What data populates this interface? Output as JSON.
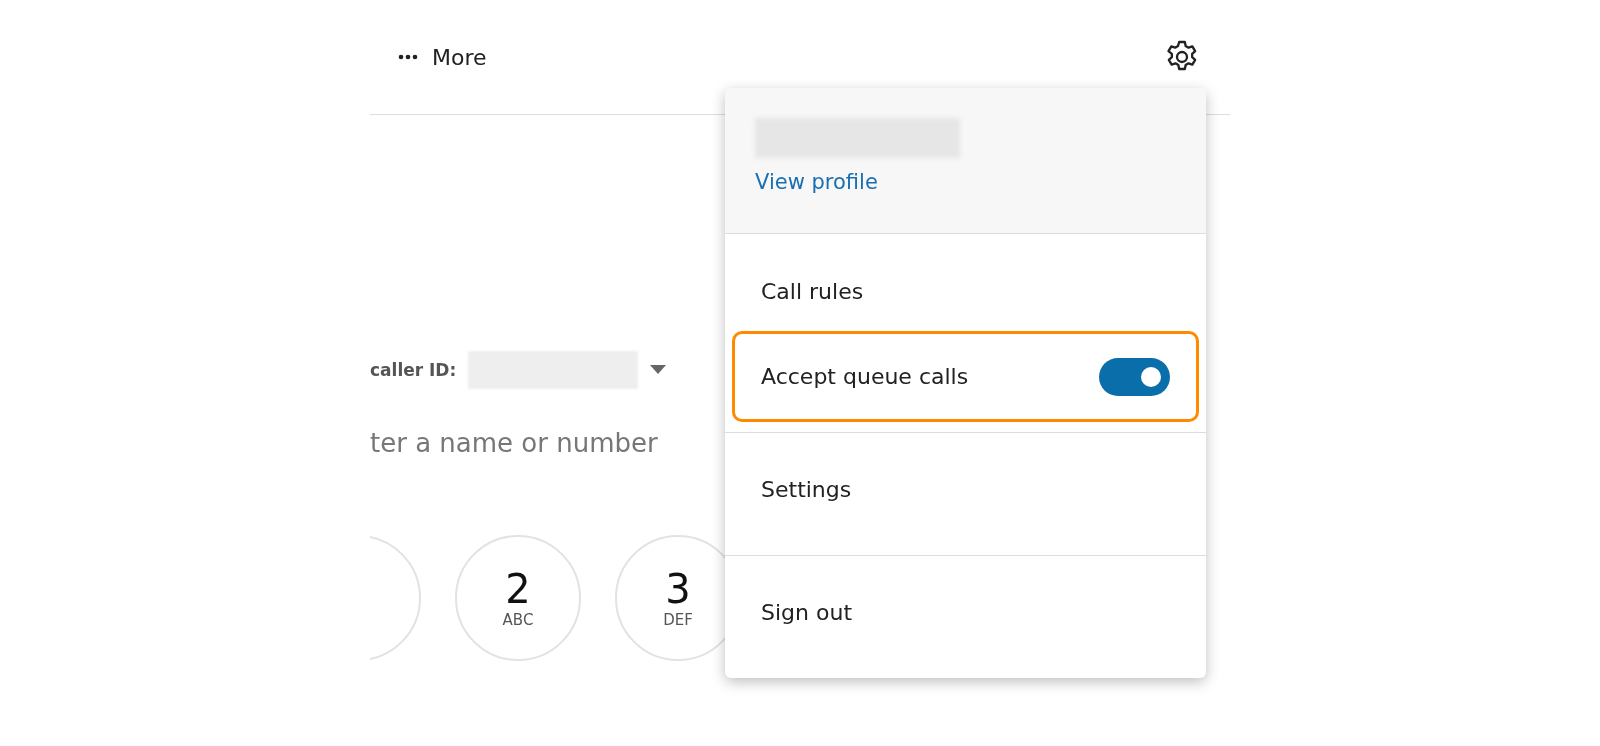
{
  "toolbar": {
    "more_label": "More"
  },
  "caller_id": {
    "label": "caller ID:"
  },
  "search": {
    "placeholder": "ter a name or number"
  },
  "dialpad": [
    {
      "digit": "2",
      "letters": "ABC"
    },
    {
      "digit": "3",
      "letters": "DEF"
    }
  ],
  "menu": {
    "profile_link": "View profile",
    "items": [
      {
        "kind": "link",
        "label": "Call rules",
        "highlighted": false
      },
      {
        "kind": "toggle",
        "label": "Accept queue calls",
        "on": true,
        "highlighted": true
      },
      {
        "kind": "link",
        "label": "Settings",
        "highlighted": false
      },
      {
        "kind": "link",
        "label": "Sign out",
        "highlighted": false
      }
    ]
  }
}
